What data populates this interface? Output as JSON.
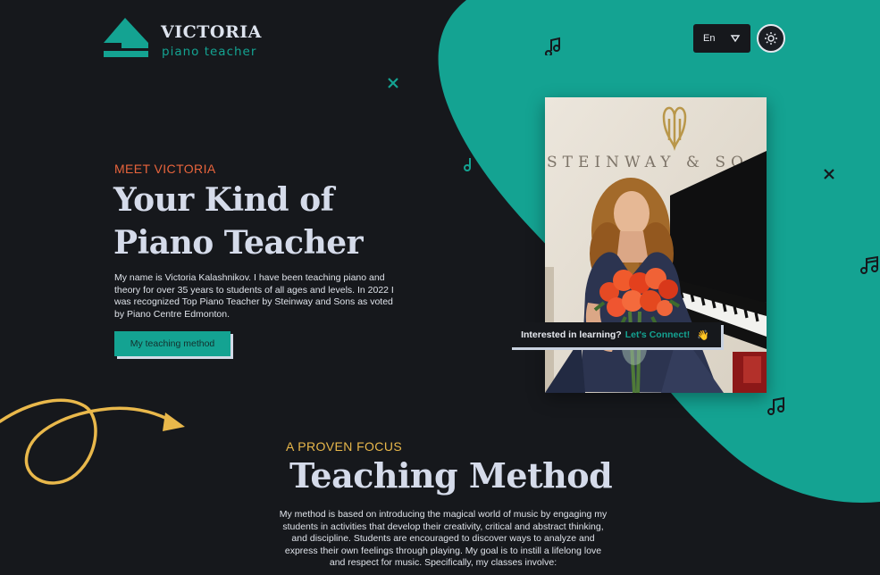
{
  "brand": {
    "name": "VICTORIA",
    "tagline": "piano teacher"
  },
  "header": {
    "language": "En",
    "theme_toggle_icon": "sun-icon"
  },
  "hero": {
    "eyebrow": "MEET VICTORIA",
    "title": "Your Kind of Piano Teacher",
    "description": "My name is Victoria Kalashnikov. I have been teaching piano and theory for over 35 years to students of all ages and levels. In 2022 I was recognized Top Piano Teacher by Steinway and Sons as voted by Piano Centre Edmonton.",
    "cta_label": "My teaching method",
    "photo_caption_text": "STEINWAY & SO"
  },
  "connect": {
    "question": "Interested in learning?",
    "link": "Let's Connect!",
    "emoji": "👋"
  },
  "method": {
    "eyebrow": "A PROVEN FOCUS",
    "title": "Teaching Method",
    "text": "My method is based on introducing the magical world of music by engaging my students in activities that develop their creativity, critical and abstract thinking, and discipline. Students are encouraged to discover ways to analyze and express their own feelings through playing. My goal is to instill a lifelong love and respect for music. Specifically, my classes involve:"
  },
  "colors": {
    "background": "#16181c",
    "teal": "#14a392",
    "orange": "#e8643c",
    "yellow": "#e9b84b",
    "heading": "#d5dbea"
  },
  "icons": [
    "music-note-icon",
    "cross-icon",
    "chevron-down-icon",
    "sun-icon",
    "curly-arrow-icon"
  ]
}
